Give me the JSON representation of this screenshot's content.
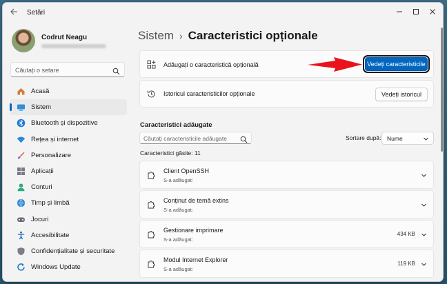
{
  "window": {
    "app_title": "Setări",
    "controls": [
      "minimize-icon",
      "maximize-icon",
      "close-icon"
    ]
  },
  "profile": {
    "name": "Codrut Neagu"
  },
  "search": {
    "placeholder": "Căutați o setare"
  },
  "nav": {
    "items": [
      {
        "label": "Acasă",
        "icon": "home-icon"
      },
      {
        "label": "Sistem",
        "icon": "system-icon",
        "active": true
      },
      {
        "label": "Bluetooth și dispozitive",
        "icon": "bluetooth-icon"
      },
      {
        "label": "Rețea și internet",
        "icon": "network-icon"
      },
      {
        "label": "Personalizare",
        "icon": "brush-icon"
      },
      {
        "label": "Aplicații",
        "icon": "apps-icon"
      },
      {
        "label": "Conturi",
        "icon": "account-icon"
      },
      {
        "label": "Timp și limbă",
        "icon": "globe-clock-icon"
      },
      {
        "label": "Jocuri",
        "icon": "gamepad-icon"
      },
      {
        "label": "Accesibilitate",
        "icon": "accessibility-icon"
      },
      {
        "label": "Confidențialitate și securitate",
        "icon": "shield-icon"
      },
      {
        "label": "Windows Update",
        "icon": "update-icon"
      }
    ]
  },
  "breadcrumb": {
    "parent": "Sistem",
    "separator": "›",
    "current": "Caracteristici opționale"
  },
  "add_feature": {
    "label": "Adăugați o caracteristică opțională",
    "button": "Vedeți caracteristicile"
  },
  "history": {
    "label": "Istoricul caracteristicilor opționale",
    "button": "Vedeți istoricul"
  },
  "installed": {
    "title": "Caracteristici adăugate",
    "search_placeholder": "Căutați caracteristicile adăugate",
    "sort_label": "Sortare după:",
    "sort_value": "Nume",
    "found": "Caracteristici găsite: 11",
    "features": [
      {
        "name": "Client OpenSSH",
        "status": "S-a adăugat:",
        "size": ""
      },
      {
        "name": "Conținut de temă extins",
        "status": "S-a adăugat:",
        "size": ""
      },
      {
        "name": "Gestionare imprimare",
        "status": "S-a adăugat:",
        "size": "434 KB"
      },
      {
        "name": "Modul Internet Explorer",
        "status": "S-a adăugat:",
        "size": "119 KB"
      }
    ]
  },
  "colors": {
    "accent": "#0067c0",
    "annotation_arrow": "#e8141c"
  }
}
